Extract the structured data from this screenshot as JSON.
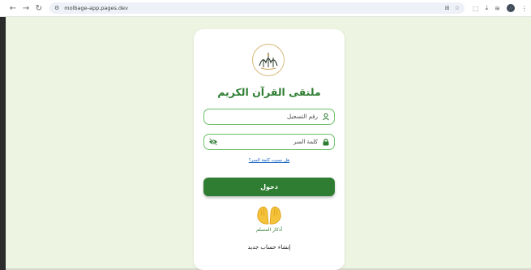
{
  "browser": {
    "url": "molbage-app.pages.dev",
    "profile_initial": "W"
  },
  "login": {
    "title": "ملتقى القرآن الكريم",
    "registration_label": "رقم التسجيل",
    "password_label": "كلمة السر",
    "forgot_link": "هل نسيت كلمة السر؟",
    "login_button": "دخول",
    "azkar_label": "أذكار المسلم",
    "create_account": "إنشاء حساب جديد"
  },
  "colors": {
    "accent": "#2e7d32",
    "field_border": "#6abf69",
    "background": "#eef4e2"
  },
  "icons": {
    "user": "user-icon",
    "lock": "lock-icon",
    "eye": "eye-slash-icon",
    "hands": "praying-hands-icon"
  }
}
